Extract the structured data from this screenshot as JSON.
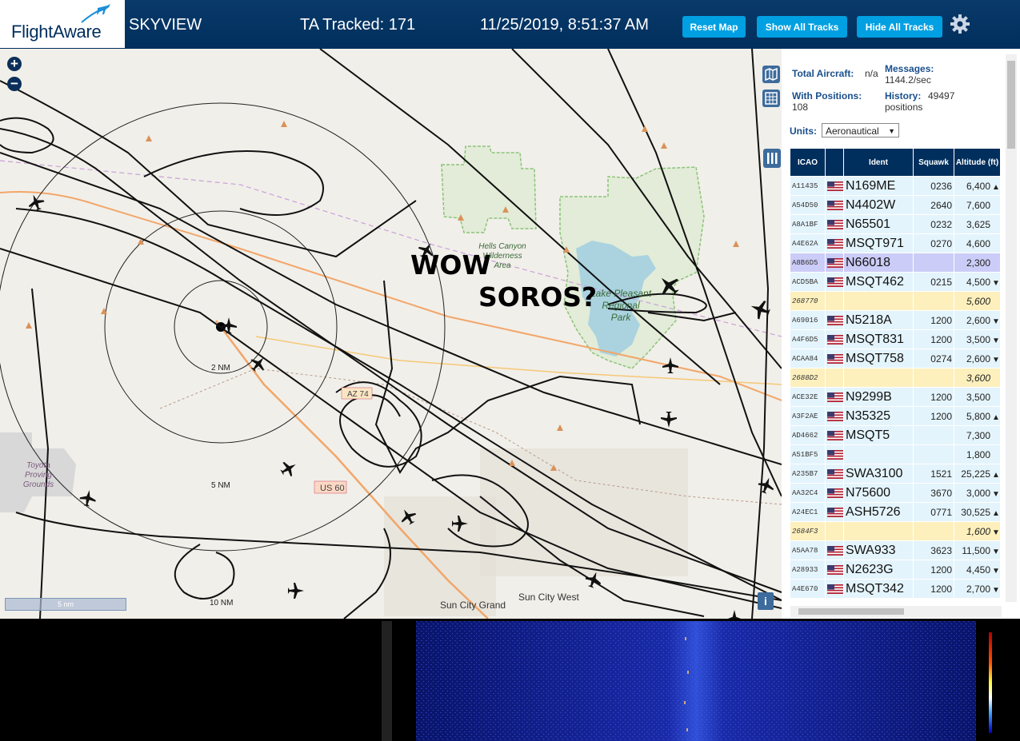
{
  "header": {
    "logo_text": "FlightAware",
    "app_title": "SKYVIEW",
    "ta_tracked": "TA Tracked: 171",
    "datetime": "11/25/2019, 8:51:37 AM",
    "buttons": {
      "reset_map": "Reset Map",
      "show_all_tracks": "Show All Tracks",
      "hide_all_tracks": "Hide All Tracks"
    },
    "settings_icon": "gear-icon"
  },
  "map": {
    "zoom_in": "+",
    "zoom_out": "−",
    "overlay_text_1": "WOW",
    "overlay_text_2": "SOROS?",
    "labels": {
      "hells_canyon": [
        "Hells Canyon",
        "Wilderness",
        "Area"
      ],
      "lake_pleasant": [
        "Lake Pleasant",
        "Regional",
        "Park"
      ],
      "toyota": [
        "Toyota",
        "Proving",
        "Grounds"
      ],
      "sun_city_grand": "Sun City Grand",
      "sun_city_west": "Sun City West",
      "az74": "AZ 74",
      "us60": "US 60",
      "ring_2": "2 NM",
      "ring_5": "5 NM",
      "ring_10": "10 NM"
    },
    "scale_label": "5 nm",
    "info_button": "i",
    "colors": {
      "land": "#f1efe9",
      "park": "#cde8c4",
      "water": "#aad3df",
      "tracks": "#111111"
    }
  },
  "panel": {
    "total_aircraft_label": "Total Aircraft:",
    "total_aircraft_value": "n/a",
    "messages_label": "Messages:",
    "messages_value": "1144.2/sec",
    "with_positions_label": "With Positions:",
    "with_positions_value": "108",
    "history_label": "History:",
    "history_value": "49497",
    "history_unit": "positions",
    "units_label": "Units:",
    "units_value": "Aeronautical",
    "columns": [
      "ICAO",
      "",
      "Ident",
      "Squawk",
      "Altitude (ft)"
    ],
    "rows": [
      {
        "icao": "A11435",
        "flag": true,
        "ident": "N169ME",
        "squawk": "0236",
        "alt": "6,400",
        "trend": "▲",
        "type": "norm"
      },
      {
        "icao": "A54D50",
        "flag": true,
        "ident": "N4402W",
        "squawk": "2640",
        "alt": "7,600",
        "trend": "",
        "type": "norm"
      },
      {
        "icao": "A8A1BF",
        "flag": true,
        "ident": "N65501",
        "squawk": "0232",
        "alt": "3,625",
        "trend": "",
        "type": "norm"
      },
      {
        "icao": "A4E62A",
        "flag": true,
        "ident": "MSQT971",
        "squawk": "0270",
        "alt": "4,600",
        "trend": "",
        "type": "norm"
      },
      {
        "icao": "A8B6D5",
        "flag": true,
        "ident": "N66018",
        "squawk": "",
        "alt": "2,300",
        "trend": "",
        "type": "sel"
      },
      {
        "icao": "ACD5BA",
        "flag": true,
        "ident": "MSQT462",
        "squawk": "0215",
        "alt": "4,500",
        "trend": "▼",
        "type": "norm"
      },
      {
        "icao": "268770",
        "flag": false,
        "ident": "",
        "squawk": "",
        "alt": "5,600",
        "trend": "",
        "type": "mlat"
      },
      {
        "icao": "A69016",
        "flag": true,
        "ident": "N5218A",
        "squawk": "1200",
        "alt": "2,600",
        "trend": "▼",
        "type": "norm"
      },
      {
        "icao": "A4F6D5",
        "flag": true,
        "ident": "MSQT831",
        "squawk": "1200",
        "alt": "3,500",
        "trend": "▼",
        "type": "norm"
      },
      {
        "icao": "ACAA84",
        "flag": true,
        "ident": "MSQT758",
        "squawk": "0274",
        "alt": "2,600",
        "trend": "▼",
        "type": "norm"
      },
      {
        "icao": "2688D2",
        "flag": false,
        "ident": "",
        "squawk": "",
        "alt": "3,600",
        "trend": "",
        "type": "mlat"
      },
      {
        "icao": "ACE32E",
        "flag": true,
        "ident": "N9299B",
        "squawk": "1200",
        "alt": "3,500",
        "trend": "",
        "type": "norm"
      },
      {
        "icao": "A3F2AE",
        "flag": true,
        "ident": "N35325",
        "squawk": "1200",
        "alt": "5,800",
        "trend": "▲",
        "type": "norm"
      },
      {
        "icao": "AD4662",
        "flag": true,
        "ident": "MSQT5",
        "squawk": "",
        "alt": "7,300",
        "trend": "",
        "type": "norm"
      },
      {
        "icao": "A51BF5",
        "flag": true,
        "ident": "",
        "squawk": "",
        "alt": "1,800",
        "trend": "",
        "type": "norm"
      },
      {
        "icao": "A235B7",
        "flag": true,
        "ident": "SWA3100",
        "squawk": "1521",
        "alt": "25,225",
        "trend": "▲",
        "type": "norm"
      },
      {
        "icao": "AA32C4",
        "flag": true,
        "ident": "N75600",
        "squawk": "3670",
        "alt": "3,000",
        "trend": "▼",
        "type": "norm"
      },
      {
        "icao": "A24EC1",
        "flag": true,
        "ident": "ASH5726",
        "squawk": "0771",
        "alt": "30,525",
        "trend": "▲",
        "type": "norm"
      },
      {
        "icao": "2684F3",
        "flag": false,
        "ident": "",
        "squawk": "",
        "alt": "1,600",
        "trend": "▼",
        "type": "mlat"
      },
      {
        "icao": "A5AA78",
        "flag": true,
        "ident": "SWA933",
        "squawk": "3623",
        "alt": "11,500",
        "trend": "▼",
        "type": "norm"
      },
      {
        "icao": "A28933",
        "flag": true,
        "ident": "N2623G",
        "squawk": "1200",
        "alt": "4,450",
        "trend": "▼",
        "type": "norm"
      },
      {
        "icao": "A4E670",
        "flag": true,
        "ident": "MSQT342",
        "squawk": "1200",
        "alt": "2,700",
        "trend": "▼",
        "type": "norm"
      }
    ]
  },
  "waterfall": {
    "colors": {
      "background": "#0a1a8a",
      "signal": "#ffe08a",
      "scale_top": "#b00000",
      "scale_bottom": "#0000c0"
    }
  }
}
